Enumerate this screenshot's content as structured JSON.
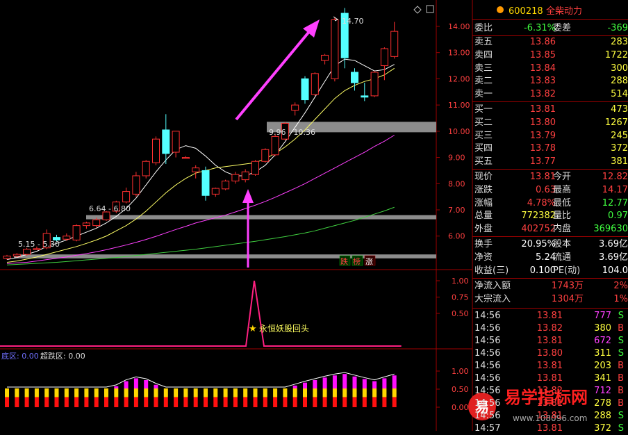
{
  "header": {
    "stock_code": "600218",
    "stock_name": "全柴动力"
  },
  "chart_labels": {
    "price_high": "14.70",
    "zone_top": "9.96 - 10.36",
    "zone_mid": "6.64 - 6.80",
    "zone_low": "5.15 - 5.30",
    "annotation": "永恒妖股回头",
    "badges": [
      "跌",
      "榜",
      "涨"
    ],
    "bottom_left": "底区: 0.00",
    "bottom_right": "超跌区: 0.00",
    "watermark_site": "易学指标网",
    "watermark_url": "www.108096.com",
    "watermark_logo": "易"
  },
  "chart_data": {
    "type": "candlestick",
    "price_axis": [
      "14.00",
      "13.00",
      "12.00",
      "11.00",
      "10.00",
      "9.00",
      "8.00",
      "7.00",
      "6.00"
    ],
    "signal_axis": [
      "1.00",
      "0.75",
      "0.50"
    ],
    "bottom_axis": [
      "1.00",
      "0.50",
      "0.00"
    ],
    "ylim": [
      4.8,
      14.9
    ],
    "candles": [
      {
        "o": 5.15,
        "h": 5.28,
        "l": 5.1,
        "c": 5.24
      },
      {
        "o": 5.24,
        "h": 5.35,
        "l": 5.18,
        "c": 5.3
      },
      {
        "o": 5.3,
        "h": 5.55,
        "l": 5.25,
        "c": 5.5
      },
      {
        "o": 5.52,
        "h": 5.6,
        "l": 5.47,
        "c": 5.52
      },
      {
        "o": 5.55,
        "h": 6.25,
        "l": 5.5,
        "c": 6.1
      },
      {
        "o": 5.95,
        "h": 6.05,
        "l": 5.8,
        "c": 5.85
      },
      {
        "o": 5.88,
        "h": 6.1,
        "l": 5.82,
        "c": 6.0
      },
      {
        "o": 5.85,
        "h": 6.45,
        "l": 5.8,
        "c": 6.4
      },
      {
        "o": 6.4,
        "h": 6.55,
        "l": 6.28,
        "c": 6.5
      },
      {
        "o": 6.4,
        "h": 6.7,
        "l": 6.32,
        "c": 6.62
      },
      {
        "o": 6.62,
        "h": 6.95,
        "l": 6.58,
        "c": 6.92
      },
      {
        "o": 6.95,
        "h": 7.35,
        "l": 6.88,
        "c": 7.3
      },
      {
        "o": 7.3,
        "h": 7.85,
        "l": 7.25,
        "c": 7.7
      },
      {
        "o": 7.6,
        "h": 8.45,
        "l": 7.5,
        "c": 8.3
      },
      {
        "o": 8.3,
        "h": 8.9,
        "l": 8.2,
        "c": 8.85
      },
      {
        "o": 8.8,
        "h": 9.8,
        "l": 8.7,
        "c": 9.7
      },
      {
        "o": 10.05,
        "h": 10.65,
        "l": 8.75,
        "c": 9.15
      },
      {
        "o": 9.2,
        "h": 10.0,
        "l": 9.0,
        "c": 10.0
      },
      {
        "o": 9.0,
        "h": 9.05,
        "l": 8.95,
        "c": 9.0
      },
      {
        "o": 8.45,
        "h": 8.7,
        "l": 8.2,
        "c": 8.6
      },
      {
        "o": 8.5,
        "h": 8.65,
        "l": 7.35,
        "c": 7.55
      },
      {
        "o": 7.6,
        "h": 7.85,
        "l": 7.5,
        "c": 7.82
      },
      {
        "o": 7.8,
        "h": 8.15,
        "l": 7.75,
        "c": 8.1
      },
      {
        "o": 8.1,
        "h": 8.45,
        "l": 8.0,
        "c": 8.35
      },
      {
        "o": 8.15,
        "h": 8.55,
        "l": 8.05,
        "c": 8.45
      },
      {
        "o": 8.35,
        "h": 8.9,
        "l": 8.3,
        "c": 8.85
      },
      {
        "o": 8.85,
        "h": 9.35,
        "l": 8.8,
        "c": 9.3
      },
      {
        "o": 9.1,
        "h": 9.9,
        "l": 9.05,
        "c": 9.8
      },
      {
        "o": 9.7,
        "h": 10.35,
        "l": 9.65,
        "c": 10.3
      },
      {
        "o": 10.8,
        "h": 11.1,
        "l": 10.6,
        "c": 11.0
      },
      {
        "o": 12.0,
        "h": 12.1,
        "l": 11.05,
        "c": 11.2
      },
      {
        "o": 11.4,
        "h": 12.25,
        "l": 11.35,
        "c": 12.2
      },
      {
        "o": 12.7,
        "h": 12.95,
        "l": 12.55,
        "c": 12.9
      },
      {
        "o": 12.0,
        "h": 14.35,
        "l": 11.9,
        "c": 14.25
      },
      {
        "o": 14.5,
        "h": 14.7,
        "l": 12.4,
        "c": 12.8
      },
      {
        "o": 12.25,
        "h": 12.4,
        "l": 11.55,
        "c": 11.85
      },
      {
        "o": 11.35,
        "h": 11.85,
        "l": 11.15,
        "c": 11.3
      },
      {
        "o": 11.35,
        "h": 12.3,
        "l": 11.3,
        "c": 12.25
      },
      {
        "o": 12.5,
        "h": 13.2,
        "l": 11.95,
        "c": 13.15
      },
      {
        "o": 12.85,
        "h": 14.17,
        "l": 12.77,
        "c": 13.81
      }
    ],
    "ma_short": [
      5.1,
      5.18,
      5.3,
      5.42,
      5.6,
      5.72,
      5.85,
      6.0,
      6.15,
      6.3,
      6.5,
      6.75,
      7.05,
      7.45,
      7.95,
      8.45,
      8.9,
      9.3,
      9.45,
      9.35,
      9.05,
      8.7,
      8.45,
      8.3,
      8.3,
      8.45,
      8.7,
      9.1,
      9.6,
      10.15,
      10.7,
      11.3,
      11.9,
      12.5,
      12.75,
      12.7,
      12.5,
      12.3,
      12.35,
      12.55
    ],
    "ma_mid": [
      5.0,
      5.05,
      5.12,
      5.2,
      5.3,
      5.4,
      5.5,
      5.6,
      5.72,
      5.85,
      6.0,
      6.2,
      6.4,
      6.65,
      6.95,
      7.3,
      7.65,
      7.95,
      8.2,
      8.4,
      8.5,
      8.6,
      8.65,
      8.7,
      8.75,
      8.8,
      8.95,
      9.15,
      9.4,
      9.7,
      10.05,
      10.45,
      10.85,
      11.25,
      11.55,
      11.75,
      11.9,
      12.0,
      12.15,
      12.4
    ],
    "ma_long": [
      4.95,
      4.98,
      5.0,
      5.05,
      5.1,
      5.15,
      5.2,
      5.27,
      5.33,
      5.4,
      5.48,
      5.57,
      5.66,
      5.76,
      5.87,
      5.99,
      6.12,
      6.25,
      6.37,
      6.5,
      6.6,
      6.7,
      6.8,
      6.92,
      7.05,
      7.18,
      7.32,
      7.48,
      7.65,
      7.82,
      8.0,
      8.2,
      8.4,
      8.6,
      8.8,
      9.0,
      9.2,
      9.42,
      9.62,
      9.85
    ],
    "ma_vlong": [
      4.9,
      4.92,
      4.94,
      4.96,
      4.98,
      5.0,
      5.03,
      5.06,
      5.09,
      5.12,
      5.15,
      5.18,
      5.22,
      5.26,
      5.3,
      5.34,
      5.38,
      5.42,
      5.46,
      5.5,
      5.55,
      5.6,
      5.65,
      5.7,
      5.75,
      5.8,
      5.86,
      5.92,
      5.98,
      6.05,
      6.12,
      6.2,
      6.3,
      6.4,
      6.5,
      6.6,
      6.72,
      6.84,
      6.96,
      7.1
    ],
    "zones": [
      {
        "low": 9.96,
        "high": 10.36
      },
      {
        "low": 6.64,
        "high": 6.8
      },
      {
        "low": 5.15,
        "high": 5.3
      }
    ],
    "signal_spike_index": 20,
    "bottom_bars": [
      0.02,
      0.05,
      0.08,
      0.1,
      0.13,
      0.15,
      0.18,
      0.22,
      0.28,
      0.35,
      0.45,
      0.58,
      0.72,
      0.8,
      0.75,
      0.62,
      0.48,
      0.35,
      0.3,
      0.25,
      0.2,
      0.22,
      0.25,
      0.28,
      0.32,
      0.36,
      0.4,
      0.45,
      0.52,
      0.6,
      0.68,
      0.75,
      0.82,
      0.88,
      0.92,
      0.85,
      0.78,
      0.72,
      0.8,
      0.88
    ]
  },
  "quote": {
    "weibi_label": "委比",
    "weibi_value": "-6.31%",
    "weicha_label": "委差",
    "weicha_value": "-369",
    "asks": [
      {
        "label": "卖五",
        "price": "13.86",
        "vol": "283"
      },
      {
        "label": "卖四",
        "price": "13.85",
        "vol": "1722"
      },
      {
        "label": "卖三",
        "price": "13.84",
        "vol": "300"
      },
      {
        "label": "卖二",
        "price": "13.83",
        "vol": "288"
      },
      {
        "label": "卖一",
        "price": "13.82",
        "vol": "514"
      }
    ],
    "bids": [
      {
        "label": "买一",
        "price": "13.81",
        "vol": "473"
      },
      {
        "label": "买二",
        "price": "13.80",
        "vol": "1267"
      },
      {
        "label": "买三",
        "price": "13.79",
        "vol": "245"
      },
      {
        "label": "买四",
        "price": "13.78",
        "vol": "372"
      },
      {
        "label": "买五",
        "price": "13.77",
        "vol": "381"
      }
    ],
    "stats": [
      {
        "l1": "现价",
        "v1": "13.81",
        "l2": "今开",
        "v2": "12.82",
        "c1": "#ff4040",
        "c2": "#ff4040"
      },
      {
        "l1": "涨跌",
        "v1": "0.63",
        "l2": "最高",
        "v2": "14.17",
        "c1": "#ff4040",
        "c2": "#ff4040"
      },
      {
        "l1": "涨幅",
        "v1": "4.78%",
        "l2": "最低",
        "v2": "12.77",
        "c1": "#ff4040",
        "c2": "#40ff40"
      },
      {
        "l1": "总量",
        "v1": "772382",
        "l2": "量比",
        "v2": "0.97",
        "c1": "#ffff40",
        "c2": "#40ff40"
      },
      {
        "l1": "外盘",
        "v1": "402752",
        "l2": "内盘",
        "v2": "369630",
        "c1": "#ff4040",
        "c2": "#40ff40"
      }
    ],
    "stats2": [
      {
        "l1": "换手",
        "v1": "20.95%",
        "l2": "股本",
        "v2": "3.69亿"
      },
      {
        "l1": "净资",
        "v1": "5.24",
        "l2": "流通",
        "v2": "3.69亿"
      },
      {
        "l1": "收益(三)",
        "v1": "0.100",
        "l2": "PE(动)",
        "v2": "104.0"
      }
    ],
    "flow": [
      {
        "label": "净流入额",
        "value": "1743万",
        "pct": "2%"
      },
      {
        "label": "大宗流入",
        "value": "1304万",
        "pct": "1%"
      }
    ]
  },
  "ticks": [
    {
      "time": "14:56",
      "price": "13.81",
      "vol": "777",
      "side": "S",
      "pc": "#ff4040",
      "vc": "#ff40ff"
    },
    {
      "time": "14:56",
      "price": "13.82",
      "vol": "380",
      "side": "B",
      "pc": "#ff4040",
      "vc": "#ffff40"
    },
    {
      "time": "14:56",
      "price": "13.81",
      "vol": "672",
      "side": "S",
      "pc": "#ff4040",
      "vc": "#ff40ff"
    },
    {
      "time": "14:56",
      "price": "13.80",
      "vol": "311",
      "side": "S",
      "pc": "#ff4040",
      "vc": "#ffff40"
    },
    {
      "time": "14:56",
      "price": "13.81",
      "vol": "203",
      "side": "B",
      "pc": "#ff4040",
      "vc": "#ffff40"
    },
    {
      "time": "14:56",
      "price": "13.81",
      "vol": "341",
      "side": "B",
      "pc": "#ff4040",
      "vc": "#ffff40"
    },
    {
      "time": "14:56",
      "price": "13.82",
      "vol": "712",
      "side": "B",
      "pc": "#ff4040",
      "vc": "#ff40ff"
    },
    {
      "time": "14:56",
      "price": "13.81",
      "vol": "278",
      "side": "B",
      "pc": "#ff4040",
      "vc": "#ffff40"
    },
    {
      "time": "14:56",
      "price": "13.81",
      "vol": "288",
      "side": "S",
      "pc": "#ff4040",
      "vc": "#ffff40"
    },
    {
      "time": "14:57",
      "price": "13.81",
      "vol": "372",
      "side": "S",
      "pc": "#ff4040",
      "vc": "#ffff40"
    }
  ],
  "colors": {
    "up": "#ff3030",
    "down": "#54ffff",
    "border": "#a00000",
    "accent": "#ff40ff"
  }
}
